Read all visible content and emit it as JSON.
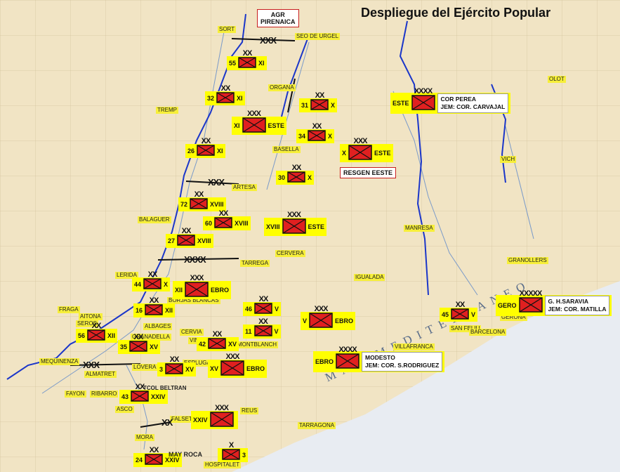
{
  "title": "Despliegue del Ejército Popular",
  "sea_label": "MAR MEDITERRANEO",
  "colors": {
    "frontline": "#1b36c9",
    "unit_fill": "#e02020",
    "highlight": "#ffff00",
    "river": "#2255cc"
  },
  "places": [
    {
      "t": "SORT"
    },
    {
      "t": "SEO DE URGEL"
    },
    {
      "t": "ORGANA"
    },
    {
      "t": "TREMP"
    },
    {
      "t": "BASELLA"
    },
    {
      "t": "ARTESA"
    },
    {
      "t": "BALAGUER"
    },
    {
      "t": "CERVERA"
    },
    {
      "t": "TARREGA"
    },
    {
      "t": "MANRESA"
    },
    {
      "t": "VICH"
    },
    {
      "t": "OLOT"
    },
    {
      "t": "GRANOLLERS"
    },
    {
      "t": "IGUALADA"
    },
    {
      "t": "LERIDA"
    },
    {
      "t": "BORJAS BLANCAS"
    },
    {
      "t": "FRAGA"
    },
    {
      "t": "AITONA"
    },
    {
      "t": "SEROS"
    },
    {
      "t": "ALBAGES"
    },
    {
      "t": "CERVIA"
    },
    {
      "t": "MONTBLANCH"
    },
    {
      "t": "VILLAFRANCA"
    },
    {
      "t": "SAN FELIU"
    },
    {
      "t": "BARCELONA"
    },
    {
      "t": "GERONA"
    },
    {
      "t": "MEQUINENZA"
    },
    {
      "t": "ALMATRET"
    },
    {
      "t": "FAYON"
    },
    {
      "t": "RIBARRO"
    },
    {
      "t": "ASCO"
    },
    {
      "t": "GRANADELLA"
    },
    {
      "t": "LOVERA"
    },
    {
      "t": "FALSET"
    },
    {
      "t": "REUS"
    },
    {
      "t": "TARRAGONA"
    },
    {
      "t": "MORA"
    },
    {
      "t": "HOSPITALET"
    },
    {
      "t": "VINAIXA"
    },
    {
      "t": "ESPLUGA"
    }
  ],
  "boxes": [
    {
      "lines": [
        "AGR",
        "PIRENAICA"
      ]
    },
    {
      "lines": [
        "RESGEN  EESTE"
      ]
    }
  ],
  "units": [
    {
      "num": "55",
      "echelon": "XX",
      "label": "XI",
      "size": "s"
    },
    {
      "num": "32",
      "echelon": "XX",
      "label": "XI",
      "size": "s"
    },
    {
      "num": "31",
      "echelon": "XX",
      "label": "X",
      "size": "s"
    },
    {
      "num": "XI",
      "echelon": "XXX",
      "label": "ESTE",
      "size": "m"
    },
    {
      "num": "34",
      "echelon": "XX",
      "label": "X",
      "size": "s"
    },
    {
      "num": "X",
      "echelon": "XXX",
      "label": "ESTE",
      "size": "m"
    },
    {
      "num": "26",
      "echelon": "XX",
      "label": "XI",
      "size": "s"
    },
    {
      "num": "30",
      "echelon": "XX",
      "label": "X",
      "size": "s"
    },
    {
      "num": "72",
      "echelon": "XX",
      "label": "XVIII",
      "size": "s"
    },
    {
      "num": "60",
      "echelon": "XX",
      "label": "XVIII",
      "size": "s"
    },
    {
      "num": "XVIII",
      "echelon": "XXX",
      "label": "ESTE",
      "size": "m"
    },
    {
      "num": "27",
      "echelon": "XX",
      "label": "XVIII",
      "size": "s"
    },
    {
      "num": "44",
      "echelon": "XX",
      "label": "X",
      "size": "s"
    },
    {
      "num": "XII",
      "echelon": "XXX",
      "label": "EBRO",
      "size": "m"
    },
    {
      "num": "16",
      "echelon": "XX",
      "label": "XII",
      "size": "s"
    },
    {
      "num": "46",
      "echelon": "XX",
      "label": "V",
      "size": "s"
    },
    {
      "num": "V",
      "echelon": "XXX",
      "label": "EBRO",
      "size": "m"
    },
    {
      "num": "11",
      "echelon": "XX",
      "label": "V",
      "size": "s"
    },
    {
      "num": "45",
      "echelon": "XX",
      "label": "V",
      "size": "s"
    },
    {
      "num": "56",
      "echelon": "XX",
      "label": "XII",
      "size": "s"
    },
    {
      "num": "35",
      "echelon": "XX",
      "label": "XV",
      "size": "s"
    },
    {
      "num": "42",
      "echelon": "XX",
      "label": "XV",
      "size": "s"
    },
    {
      "num": "3",
      "echelon": "XX",
      "label": "XV",
      "size": "s"
    },
    {
      "num": "XV",
      "echelon": "XXX",
      "label": "EBRO",
      "size": "m"
    },
    {
      "num": "43",
      "echelon": "XX",
      "label": "XXIV",
      "size": "s"
    },
    {
      "num": "XXIV",
      "echelon": "XXX",
      "label": "",
      "size": "m"
    },
    {
      "num": "24",
      "echelon": "XX",
      "label": "XXIV",
      "size": "s"
    },
    {
      "num": "",
      "echelon": "X",
      "label": "3",
      "size": "s"
    }
  ],
  "army_groups": [
    {
      "prefix": "ESTE",
      "echelon": "XXXX",
      "lines": [
        "COR PEREA",
        "JEM: COR. CARVAJAL"
      ]
    },
    {
      "prefix": "EBRO",
      "echelon": "XXXX",
      "lines": [
        "MODESTO",
        "JEM: COR. S.RODRIGUEZ"
      ]
    },
    {
      "prefix": "GERO",
      "echelon": "XXXXX",
      "lines": [
        "G. H.SARAVIA",
        "JEM: COR. MATILLA"
      ]
    }
  ],
  "notes": [
    {
      "t": "TCOL BELTRAN"
    },
    {
      "t": "MAY ROCA"
    }
  ],
  "boundary_marks": [
    {
      "t": "XXX"
    },
    {
      "t": "XXX"
    },
    {
      "t": "XXXX"
    },
    {
      "t": "XXX"
    },
    {
      "t": "XX"
    }
  ]
}
